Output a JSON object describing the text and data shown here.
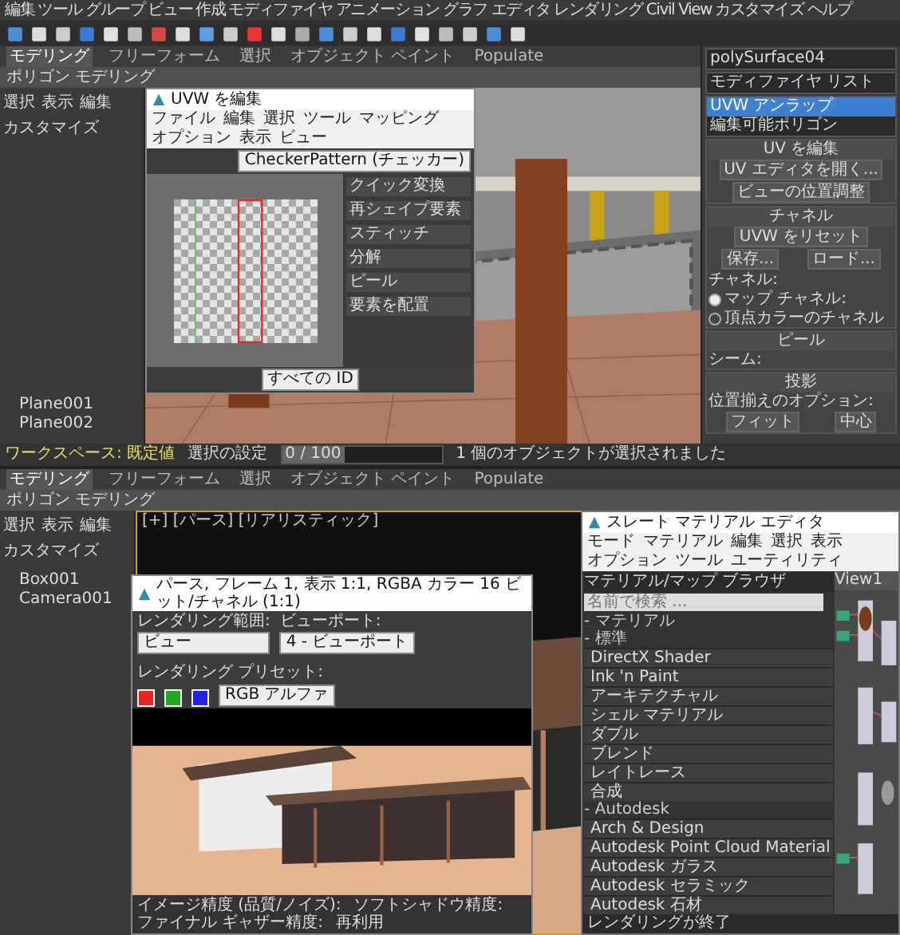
{
  "top_screen": {
    "menu": [
      "編集",
      "ツール",
      "グループ",
      "ビュー",
      "作成",
      "モディファイヤ",
      "アニメーション",
      "グラフ エディタ",
      "レンダリング",
      "Civil View",
      "カスタマイズ",
      "ヘルプ"
    ],
    "ribbon_tabs": [
      {
        "label": "モデリング",
        "selected": true
      },
      {
        "label": "フリーフォーム",
        "selected": false
      },
      {
        "label": "選択",
        "selected": false
      },
      {
        "label": "オブジェクト ペイント",
        "selected": false
      },
      {
        "label": "Populate",
        "selected": false
      }
    ],
    "ribbon_panel": "ポリゴン モデリング",
    "explorer_tabs": [
      "選択",
      "表示",
      "編集",
      "カスタマイズ"
    ],
    "scene_items": [
      "Plane001",
      "Plane002"
    ],
    "uvw_editor": {
      "title": "UVW を編集",
      "menu": [
        "ファイル",
        "編集",
        "選択",
        "ツール",
        "マッピング",
        "オプション",
        "表示",
        "ビュー"
      ],
      "texture": "CheckerPattern (チェッカー)",
      "display_mode": "すべての ID",
      "side_sections": [
        "クイック変換",
        "再シェイプ要素",
        "スティッチ",
        "分解",
        "ピール",
        "要素を配置"
      ]
    },
    "command_panel": {
      "object_name": "polySurface04",
      "modifier_list": "モディファイヤ リスト",
      "stack": [
        {
          "label": "UVW アンラップ",
          "selected": true
        },
        {
          "label": "編集可能ポリゴン",
          "selected": false
        }
      ],
      "groups": [
        {
          "title": "UV を編集",
          "items": [
            {
              "kind": "button",
              "label": "UV エディタを開く..."
            },
            {
              "kind": "button",
              "label": "ビューの位置調整"
            }
          ]
        },
        {
          "title": "チャネル",
          "items": [
            {
              "kind": "button",
              "label": "UVW をリセット"
            },
            {
              "kind": "button",
              "label": "保存..."
            },
            {
              "kind": "button",
              "label": "ロード..."
            },
            {
              "kind": "label",
              "label": "チャネル:"
            },
            {
              "kind": "radio",
              "label": "マップ チャネル:",
              "selected": true
            },
            {
              "kind": "radio",
              "label": "頂点カラーのチャネル",
              "selected": false
            }
          ]
        },
        {
          "title": "ピール",
          "items": [
            {
              "kind": "label",
              "label": "シーム:"
            }
          ]
        },
        {
          "title": "投影",
          "items": [
            {
              "kind": "label",
              "label": "位置揃えのオプション:"
            },
            {
              "kind": "button",
              "label": "フィット"
            },
            {
              "kind": "button",
              "label": "中心"
            }
          ]
        }
      ]
    },
    "status": {
      "workspace": "ワークスペース: 既定値",
      "selection_sets": "選択の設定",
      "prompt": "1 個のオブジェクトが選択されました",
      "time": {
        "label": "0 / 100",
        "level": 0
      }
    }
  },
  "bottom_screen": {
    "ribbon_tabs": [
      {
        "label": "モデリング",
        "selected": true
      },
      {
        "label": "フリーフォーム",
        "selected": false
      },
      {
        "label": "選択",
        "selected": false
      },
      {
        "label": "オブジェクト ペイント",
        "selected": false
      },
      {
        "label": "Populate",
        "selected": false
      }
    ],
    "ribbon_panel": "ポリゴン モデリング",
    "explorer_tabs": [
      "選択",
      "表示",
      "編集",
      "カスタマイズ"
    ],
    "scene_items": [
      "Box001",
      "Camera001"
    ],
    "viewport_label": "[+] [パース] [リアリスティック]",
    "render_window": {
      "title": "パース, フレーム 1, 表示 1:1, RGBA カラー 16 ビット/チャネル (1:1)",
      "area_label": "レンダリング範囲:",
      "area_value": "ビュー",
      "viewport_label": "ビューポート:",
      "viewport_value": "4 - ビューポート",
      "preset_label": "レンダリング プリセット:",
      "channel_value": "RGB アルファ",
      "settings": [
        {
          "label": "イメージ精度 (品質/ノイズ):"
        },
        {
          "label": "ソフトシャドウ精度:"
        },
        {
          "label": "ファイナル ギャザー精度:"
        },
        {
          "label": "再利用"
        }
      ]
    },
    "slate_editor": {
      "title": "スレート マテリアル エディタ",
      "menu": [
        "モード",
        "マテリアル",
        "編集",
        "選択",
        "表示",
        "オプション",
        "ツール",
        "ユーティリティ"
      ],
      "browser_title": "マテリアル/マップ ブラウザ",
      "search_placeholder": "名前で検索 ...",
      "view_tab": "View1",
      "list": [
        {
          "kind": "group",
          "label": "- マテリアル"
        },
        {
          "kind": "group",
          "label": "- 標準"
        },
        {
          "kind": "item",
          "label": "DirectX Shader"
        },
        {
          "kind": "item",
          "label": "Ink 'n Paint"
        },
        {
          "kind": "item",
          "label": "アーキテクチャル"
        },
        {
          "kind": "item",
          "label": "シェル マテリアル"
        },
        {
          "kind": "item",
          "label": "ダブル"
        },
        {
          "kind": "item",
          "label": "ブレンド"
        },
        {
          "kind": "item",
          "label": "レイトレース"
        },
        {
          "kind": "item",
          "label": "合成"
        },
        {
          "kind": "group",
          "label": "- Autodesk"
        },
        {
          "kind": "item",
          "label": "Arch & Design"
        },
        {
          "kind": "item",
          "label": "Autodesk Point Cloud Material"
        },
        {
          "kind": "item",
          "label": "Autodesk ガラス"
        },
        {
          "kind": "item",
          "label": "Autodesk セラミック"
        },
        {
          "kind": "item",
          "label": "Autodesk 石材"
        }
      ],
      "status": "レンダリングが終了"
    }
  }
}
